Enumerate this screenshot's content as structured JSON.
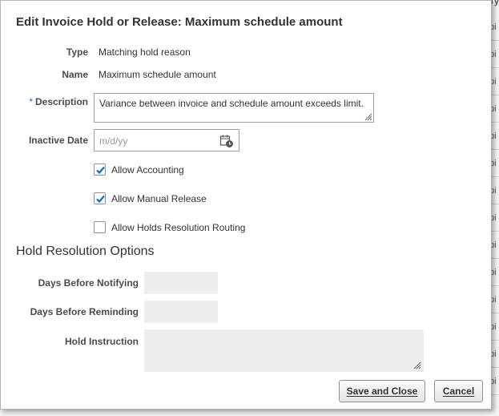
{
  "dialog": {
    "title": "Edit Invoice Hold or Release: Maximum schedule amount"
  },
  "fields": {
    "type_label": "Type",
    "type_value": "Matching hold reason",
    "name_label": "Name",
    "name_value": "Maximum schedule amount",
    "description_required_marker": "*",
    "description_label": "Description",
    "description_value": "Variance between invoice and schedule amount exceeds limit.",
    "inactive_date_label": "Inactive Date",
    "inactive_date_placeholder": "m/d/yy"
  },
  "checkboxes": [
    {
      "label": "Allow Accounting",
      "checked": true
    },
    {
      "label": "Allow Manual Release",
      "checked": true
    },
    {
      "label": "Allow Holds Resolution Routing",
      "checked": false
    }
  ],
  "resolution": {
    "section_title": "Hold Resolution Options",
    "days_notifying_label": "Days Before Notifying",
    "days_reminding_label": "Days Before Reminding",
    "hold_instruction_label": "Hold Instruction"
  },
  "buttons": {
    "save_close": "Save and Close",
    "cancel": "Cancel"
  },
  "background": {
    "column_header_fragment": "Typ",
    "row_fragments": [
      "pi",
      "pi",
      "pi",
      "pi",
      "pi",
      "pi",
      "pi",
      "pi",
      "pi",
      "pi",
      "pi",
      "pi",
      "pi",
      "pi"
    ]
  },
  "colors": {
    "required_marker": "#0572ce",
    "checkbox_check": "#0572ce",
    "readonly_field_bg": "#eeeeee"
  },
  "icons": {
    "calendar": "calendar-icon",
    "checkmark": "checkmark-icon",
    "resize": "resize-grip-icon"
  }
}
